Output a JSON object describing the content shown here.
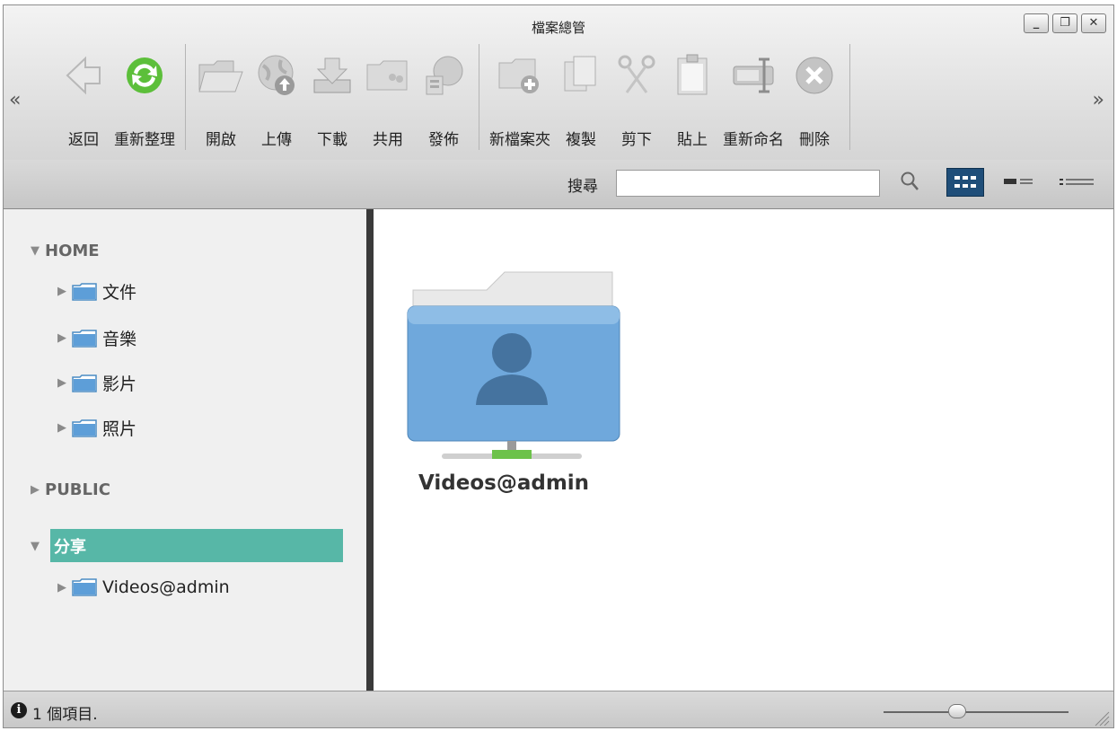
{
  "window": {
    "title": "檔案總管",
    "controls": [
      "minimize-icon",
      "restore-icon",
      "close-icon"
    ]
  },
  "nav": {
    "prev": "«",
    "next": "»"
  },
  "toolbar": {
    "back": "返回",
    "refresh": "重新整理",
    "open": "開啟",
    "upload": "上傳",
    "download": "下載",
    "share": "共用",
    "publish": "發佈",
    "new_folder": "新檔案夾",
    "copy": "複製",
    "cut": "剪下",
    "paste": "貼上",
    "rename": "重新命名",
    "delete": "刪除"
  },
  "search": {
    "label": "搜尋",
    "value": "",
    "placeholder": ""
  },
  "views": {
    "active": "grid"
  },
  "tree": {
    "home": "HOME",
    "home_children": [
      "文件",
      "音樂",
      "影片",
      "照片"
    ],
    "public": "PUBLIC",
    "share": "分享",
    "share_children": [
      "Videos@admin"
    ]
  },
  "main": {
    "items": [
      {
        "name": "Videos@admin"
      }
    ]
  },
  "status": {
    "text": "1 個項目."
  },
  "zoom": {
    "level": 0.4
  },
  "colors": {
    "accent": "#57b7a7",
    "view_active": "#1f4e79",
    "folder_blue": "#6fa8dc"
  }
}
